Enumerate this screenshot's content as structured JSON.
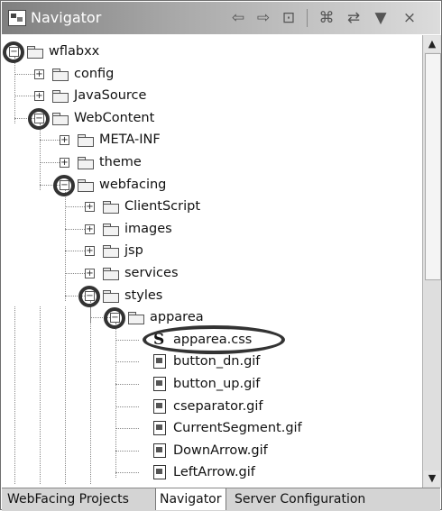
{
  "titlebar": {
    "title": "Navigator",
    "icons": [
      "back-arrow-icon",
      "forward-arrow-icon",
      "up-folder-icon",
      "collapse-all-icon",
      "link-editor-icon",
      "view-menu-icon",
      "close-icon"
    ]
  },
  "tree": [
    {
      "label": "wflabxx",
      "type": "project",
      "toggle": "−",
      "circled": true
    },
    {
      "label": "config",
      "type": "folder",
      "toggle": "+",
      "circled": false
    },
    {
      "label": "JavaSource",
      "type": "folder",
      "toggle": "+",
      "circled": false
    },
    {
      "label": "WebContent",
      "type": "folder",
      "toggle": "−",
      "circled": true
    },
    {
      "label": "META-INF",
      "type": "folder",
      "toggle": "+",
      "circled": false
    },
    {
      "label": "theme",
      "type": "folder",
      "toggle": "+",
      "circled": false
    },
    {
      "label": "webfacing",
      "type": "folder",
      "toggle": "−",
      "circled": true
    },
    {
      "label": "ClientScript",
      "type": "folder",
      "toggle": "+",
      "circled": false
    },
    {
      "label": "images",
      "type": "folder",
      "toggle": "+",
      "circled": false
    },
    {
      "label": "jsp",
      "type": "folder",
      "toggle": "+",
      "circled": false
    },
    {
      "label": "services",
      "type": "folder",
      "toggle": "+",
      "circled": false
    },
    {
      "label": "styles",
      "type": "folder",
      "toggle": "−",
      "circled": true
    },
    {
      "label": "apparea",
      "type": "folder",
      "toggle": "−",
      "circled": true
    },
    {
      "label": "apparea.css",
      "type": "css",
      "toggle": "",
      "circled": true
    },
    {
      "label": "button_dn.gif",
      "type": "gif",
      "toggle": "",
      "circled": false
    },
    {
      "label": "button_up.gif",
      "type": "gif",
      "toggle": "",
      "circled": false
    },
    {
      "label": "cseparator.gif",
      "type": "gif",
      "toggle": "",
      "circled": false
    },
    {
      "label": "CurrentSegment.gif",
      "type": "gif",
      "toggle": "",
      "circled": false
    },
    {
      "label": "DownArrow.gif",
      "type": "gif",
      "toggle": "",
      "circled": false
    },
    {
      "label": "LeftArrow.gif",
      "type": "gif",
      "toggle": "",
      "circled": false
    }
  ],
  "tabs": [
    {
      "label": "WebFacing Projects",
      "active": false
    },
    {
      "label": "Navigator",
      "active": true
    },
    {
      "label": "Server Configuration",
      "active": false
    }
  ]
}
